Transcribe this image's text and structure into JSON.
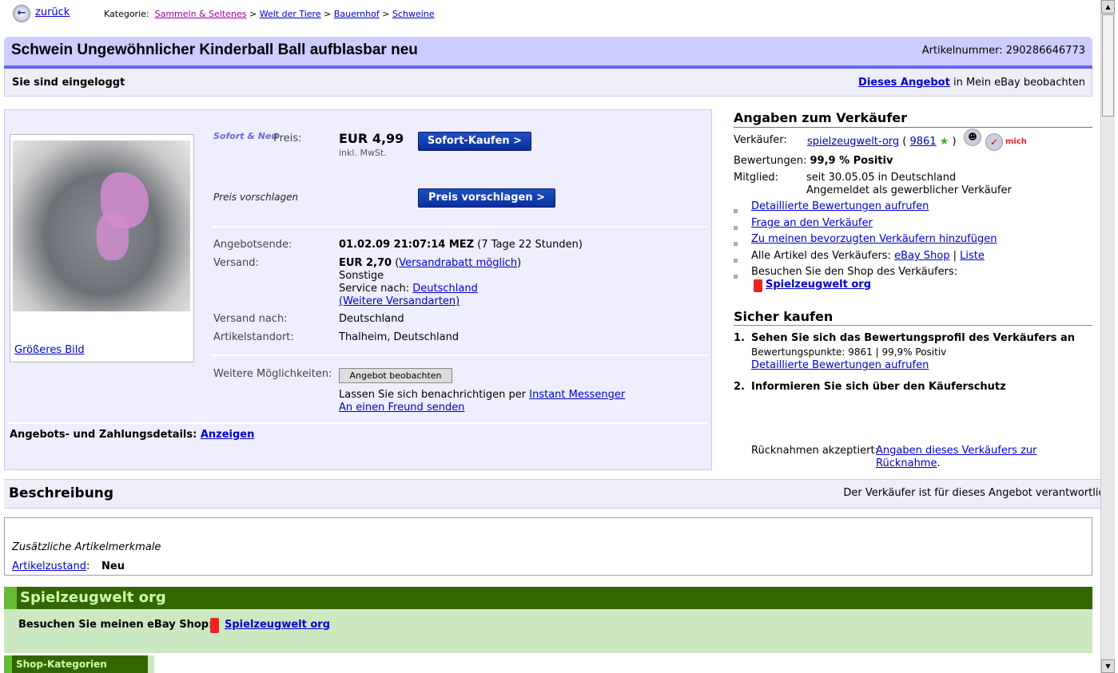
{
  "nav": {
    "back": "zurück",
    "category_label": "Kategorie:",
    "breadcrumb": [
      "Sammeln & Seltenes",
      "Welt der Tiere",
      "Bauernhof",
      "Schweine"
    ],
    "sep": ">"
  },
  "header": {
    "title": "Schwein Ungewöhnlicher Kinderball Ball aufblasbar neu",
    "item_number": "Artikelnummer: 290286646773",
    "logged_in": "Sie sind eingeloggt",
    "watch_link": "Dieses Angebot",
    "watch_rest": " in Mein eBay beobachten"
  },
  "item": {
    "logo_text": "Sofort & Neu",
    "price_label": "Preis:",
    "price": "EUR 4,99",
    "vat": "inkl. MwSt.",
    "buy_now": "Sofort-Kaufen >",
    "offer_label": "Preis vorschlagen",
    "offer_button": "Preis vorschlagen >",
    "bigger_image": "Größeres Bild",
    "end_label": "Angebotsende:",
    "end_value": "01.02.09 21:07:14 MEZ",
    "end_rest": " (7 Tage 22 Stunden)",
    "shipping_label": "Versand:",
    "shipping_price": "EUR 2,70",
    "shipping_discount": "Versandrabatt möglich",
    "shipping_method": "Sonstige",
    "service_label": "Service nach: ",
    "service_country": "Deutschland",
    "more_shipping": "(Weitere Versandarten)",
    "ship_to_label": "Versand nach:",
    "ship_to": "Deutschland",
    "location_label": "Artikelstandort:",
    "location": "Thalheim, Deutschland",
    "more_label": "Weitere Möglichkeiten:",
    "watch_button": "Angebot beobachten",
    "notify_text": "Lassen Sie sich benachrichtigen per ",
    "instant_messenger": "Instant Messenger",
    "send_friend": "An einen Freund senden",
    "details_label": "Angebots- und Zahlungsdetails:",
    "details_link": "Anzeigen"
  },
  "seller": {
    "heading": "Angaben zum Verkäufer",
    "seller_label": "Verkäufer:",
    "name": "spielzeugwelt-org",
    "score": "9861",
    "rating_label": "Bewertungen:",
    "rating": "99,9 % Positiv",
    "member_label": "Mitglied:",
    "member_since": "seit 30.05.05 in Deutschland",
    "member_type": "Angemeldet als gewerblicher Verkäufer",
    "me_badge": "mich",
    "links": [
      "Detaillierte Bewertungen aufrufen",
      "Frage an den Verkäufer",
      "Zu meinen bevorzugten Verkäufern hinzufügen"
    ],
    "all_items": "Alle Artikel des Verkäufers: ",
    "ebay_shop": "eBay Shop",
    "liste": "Liste",
    "visit_shop": "Besuchen Sie den Shop des Verkäufers:",
    "shop_name": "Spielzeugwelt org"
  },
  "safe": {
    "heading": "Sicher kaufen",
    "step1": "Sehen Sie sich das Bewertungsprofil des Verkäufers an",
    "step1_points": "Bewertungspunkte: 9861 | 99,9% Positiv",
    "step1_link": "Detaillierte Bewertungen aufrufen",
    "step2": "Informieren Sie sich über den Käuferschutz",
    "returns_label": "Rücknahmen akzeptiert:",
    "returns_link1": "Angaben dieses Verkäufers zur",
    "returns_link2": "Rücknahme"
  },
  "description": {
    "heading": "Beschreibung",
    "responsible": "Der Verkäufer ist für dieses Angebot verantwortlich.",
    "features": "Zusätzliche Artikelmerkmale",
    "condition_label": "Artikelzustand",
    "condition": "Neu"
  },
  "shop": {
    "title": "Spielzeugwelt org",
    "visit": "Besuchen Sie meinen eBay Shop:",
    "link": "Spielzeugwelt org",
    "categories": "Shop-Kategorien"
  }
}
